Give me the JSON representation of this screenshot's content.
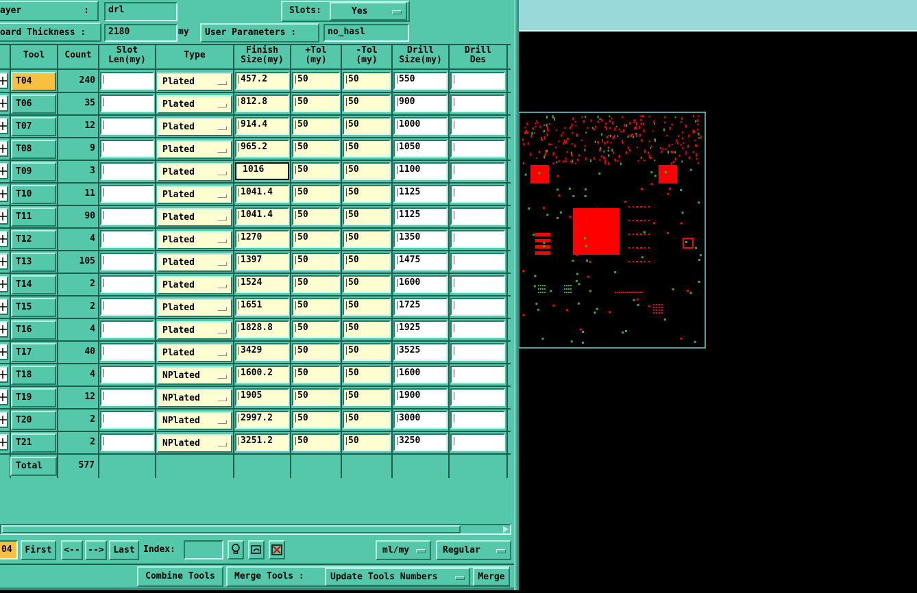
{
  "header": {
    "layer_label": "ayer",
    "layer_colon": ":",
    "layer_value": "drl",
    "slots_label": "Slots:",
    "slots_value": "Yes",
    "thickness_label": "oard Thickness :",
    "thickness_value": "2180",
    "thickness_unit": "my",
    "user_params_label": "User Parameters :",
    "user_params_value": "no_hasl"
  },
  "table": {
    "columns": [
      "Tool",
      "Count",
      "Slot\nLen(my)",
      "Type",
      "Finish\nSize(my)",
      "+Tol\n(my)",
      "-Tol\n(my)",
      "Drill\nSize(my)",
      "Drill\nDes"
    ],
    "rows": [
      {
        "tool": "T04",
        "count": "240",
        "type": "Plated",
        "finish": "457.2",
        "ptol": "50",
        "mtol": "50",
        "drill": "550"
      },
      {
        "tool": "T06",
        "count": "35",
        "type": "Plated",
        "finish": "812.8",
        "ptol": "50",
        "mtol": "50",
        "drill": "900"
      },
      {
        "tool": "T07",
        "count": "12",
        "type": "Plated",
        "finish": "914.4",
        "ptol": "50",
        "mtol": "50",
        "drill": "1000"
      },
      {
        "tool": "T08",
        "count": "9",
        "type": "Plated",
        "finish": "965.2",
        "ptol": "50",
        "mtol": "50",
        "drill": "1050"
      },
      {
        "tool": "T09",
        "count": "3",
        "type": "Plated",
        "finish": "1016",
        "ptol": "50",
        "mtol": "50",
        "drill": "1100"
      },
      {
        "tool": "T10",
        "count": "11",
        "type": "Plated",
        "finish": "1041.4",
        "ptol": "50",
        "mtol": "50",
        "drill": "1125"
      },
      {
        "tool": "T11",
        "count": "90",
        "type": "Plated",
        "finish": "1041.4",
        "ptol": "50",
        "mtol": "50",
        "drill": "1125"
      },
      {
        "tool": "T12",
        "count": "4",
        "type": "Plated",
        "finish": "1270",
        "ptol": "50",
        "mtol": "50",
        "drill": "1350"
      },
      {
        "tool": "T13",
        "count": "105",
        "type": "Plated",
        "finish": "1397",
        "ptol": "50",
        "mtol": "50",
        "drill": "1475"
      },
      {
        "tool": "T14",
        "count": "2",
        "type": "Plated",
        "finish": "1524",
        "ptol": "50",
        "mtol": "50",
        "drill": "1600"
      },
      {
        "tool": "T15",
        "count": "2",
        "type": "Plated",
        "finish": "1651",
        "ptol": "50",
        "mtol": "50",
        "drill": "1725"
      },
      {
        "tool": "T16",
        "count": "4",
        "type": "Plated",
        "finish": "1828.8",
        "ptol": "50",
        "mtol": "50",
        "drill": "1925"
      },
      {
        "tool": "T17",
        "count": "40",
        "type": "Plated",
        "finish": "3429",
        "ptol": "50",
        "mtol": "50",
        "drill": "3525"
      },
      {
        "tool": "T18",
        "count": "4",
        "type": "NPlated",
        "finish": "1600.2",
        "ptol": "50",
        "mtol": "50",
        "drill": "1600"
      },
      {
        "tool": "T19",
        "count": "12",
        "type": "NPlated",
        "finish": "1905",
        "ptol": "50",
        "mtol": "50",
        "drill": "1900"
      },
      {
        "tool": "T20",
        "count": "2",
        "type": "NPlated",
        "finish": "2997.2",
        "ptol": "50",
        "mtol": "50",
        "drill": "3000"
      },
      {
        "tool": "T21",
        "count": "2",
        "type": "NPlated",
        "finish": "3251.2",
        "ptol": "50",
        "mtol": "50",
        "drill": "3250"
      }
    ],
    "total_label": "Total",
    "total_count": "577"
  },
  "nav": {
    "current_tool": "04",
    "first": "First",
    "prev": "<--",
    "next": "-->",
    "last": "Last",
    "index_label": "Index:",
    "index_value": "",
    "units": "ml/my",
    "mode": "Regular"
  },
  "actions": {
    "combine": "Combine Tools",
    "merge_label": "Merge Tools :",
    "merge_option": "Update Tools Numbers",
    "merge_btn": "Merge"
  },
  "colors": {
    "panel": "#55c8ac",
    "selected": "#f8c040",
    "editable": "#fefed0",
    "pad_red": "#ff0000",
    "via_green": "#3caa3c",
    "board_outline": "#6fd6d6"
  },
  "icons": [
    "row-expand-icon",
    "lightbulb-icon",
    "lasso-icon",
    "delete-icon",
    "dropdown-icon"
  ]
}
